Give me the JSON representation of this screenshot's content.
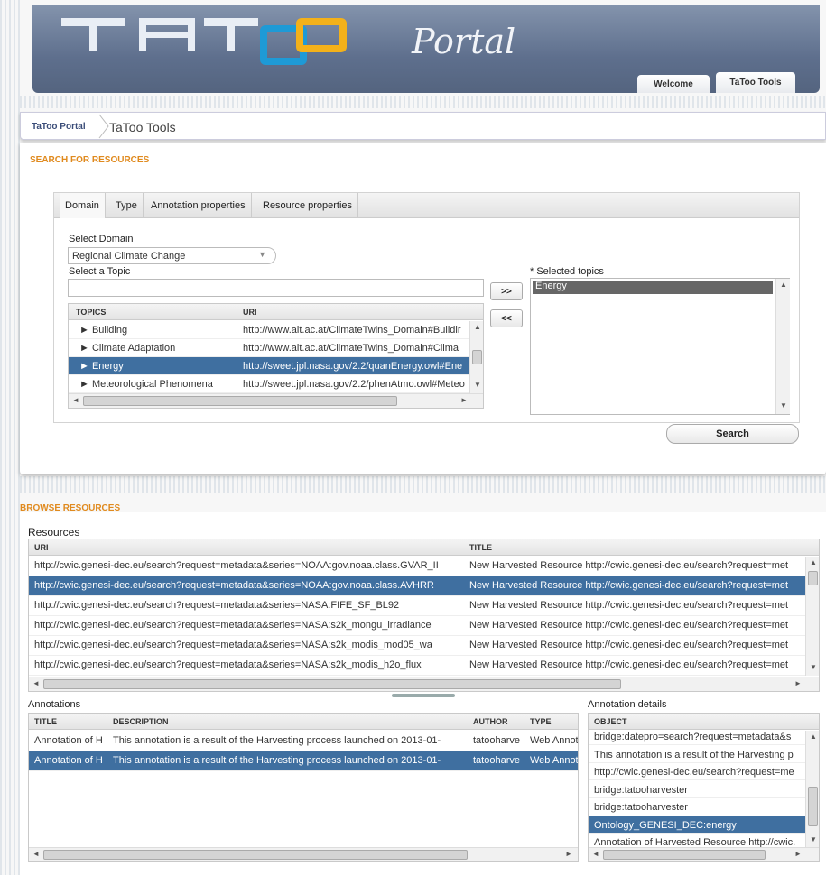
{
  "header": {
    "logo_text": "TATOO",
    "portal_text": "Portal",
    "tabs": [
      {
        "label": "Welcome"
      },
      {
        "label": "TaToo Tools"
      }
    ]
  },
  "breadcrumb": {
    "items": [
      "TaToo Portal",
      "TaToo Tools"
    ]
  },
  "search": {
    "section_title": "SEARCH FOR RESOURCES",
    "tabs": [
      "Domain",
      "Type",
      "Annotation properties",
      "Resource properties"
    ],
    "select_domain_label": "Select Domain",
    "domain_value": "Regional Climate Change",
    "select_topic_label": "Select a Topic",
    "topic_input_value": "",
    "topics_grid": {
      "headers": [
        "TOPICS",
        "URI"
      ],
      "rows": [
        {
          "topic": "► Building",
          "uri": "http://www.ait.ac.at/ClimateTwins_Domain#Buildir"
        },
        {
          "topic": "► Climate Adaptation",
          "uri": "http://www.ait.ac.at/ClimateTwins_Domain#Clima"
        },
        {
          "topic": "► Energy",
          "uri": "http://sweet.jpl.nasa.gov/2.2/quanEnergy.owl#Ene"
        },
        {
          "topic": "► Meteorological Phenomena",
          "uri": "http://sweet.jpl.nasa.gov/2.2/phenAtmo.owl#Meteo"
        }
      ],
      "selected_index": 2
    },
    "add_button": ">>",
    "remove_button": "<<",
    "selected_topics_label": "* Selected topics",
    "selected_topics": [
      "Energy"
    ],
    "search_button": "Search"
  },
  "browse": {
    "section_title": "BROWSE RESOURCES",
    "resources_label": "Resources",
    "resources_headers": [
      "URI",
      "TITLE"
    ],
    "resources_rows": [
      {
        "uri": "http://cwic.genesi-dec.eu/search?request=metadata&series=NOAA:gov.noaa.class.GVAR_II",
        "title": "New Harvested Resource http://cwic.genesi-dec.eu/search?request=met"
      },
      {
        "uri": "http://cwic.genesi-dec.eu/search?request=metadata&series=NOAA:gov.noaa.class.AVHRR",
        "title": "New Harvested Resource http://cwic.genesi-dec.eu/search?request=met"
      },
      {
        "uri": "http://cwic.genesi-dec.eu/search?request=metadata&series=NASA:FIFE_SF_BL92",
        "title": "New Harvested Resource http://cwic.genesi-dec.eu/search?request=met"
      },
      {
        "uri": "http://cwic.genesi-dec.eu/search?request=metadata&series=NASA:s2k_mongu_irradiance",
        "title": "New Harvested Resource http://cwic.genesi-dec.eu/search?request=met"
      },
      {
        "uri": "http://cwic.genesi-dec.eu/search?request=metadata&series=NASA:s2k_modis_mod05_wa",
        "title": "New Harvested Resource http://cwic.genesi-dec.eu/search?request=met"
      },
      {
        "uri": "http://cwic.genesi-dec.eu/search?request=metadata&series=NASA:s2k_modis_h2o_flux",
        "title": "New Harvested Resource http://cwic.genesi-dec.eu/search?request=met"
      }
    ],
    "resources_selected_index": 1,
    "annotations_label": "Annotations",
    "annotations_headers": [
      "TITLE",
      "DESCRIPTION",
      "AUTHOR",
      "TYPE"
    ],
    "annotations_rows": [
      {
        "title": "Annotation of H",
        "description": "This annotation is a result of the Harvesting process launched on 2013-01-",
        "author": "tatooharve",
        "type": "Web Annota"
      },
      {
        "title": "Annotation of H",
        "description": "This annotation is a result of the Harvesting process launched on 2013-01-",
        "author": "tatooharve",
        "type": "Web Annota"
      }
    ],
    "annotations_selected_index": 1,
    "details_label": "Annotation details",
    "details_header": "OBJECT",
    "details_rows": [
      "bridge:datepro=search?request=metadata&s",
      "This annotation is a result of the Harvesting p",
      "http://cwic.genesi-dec.eu/search?request=me",
      "bridge:tatooharvester",
      "bridge:tatooharvester",
      "Ontology_GENESI_DEC:energy",
      "Annotation of Harvested Resource http://cwic."
    ],
    "details_selected_index": 5
  },
  "colors": {
    "accent_orange": "#e08a1e",
    "selection_blue": "#3f6fa0",
    "header_blue": "#5e6f8d"
  }
}
